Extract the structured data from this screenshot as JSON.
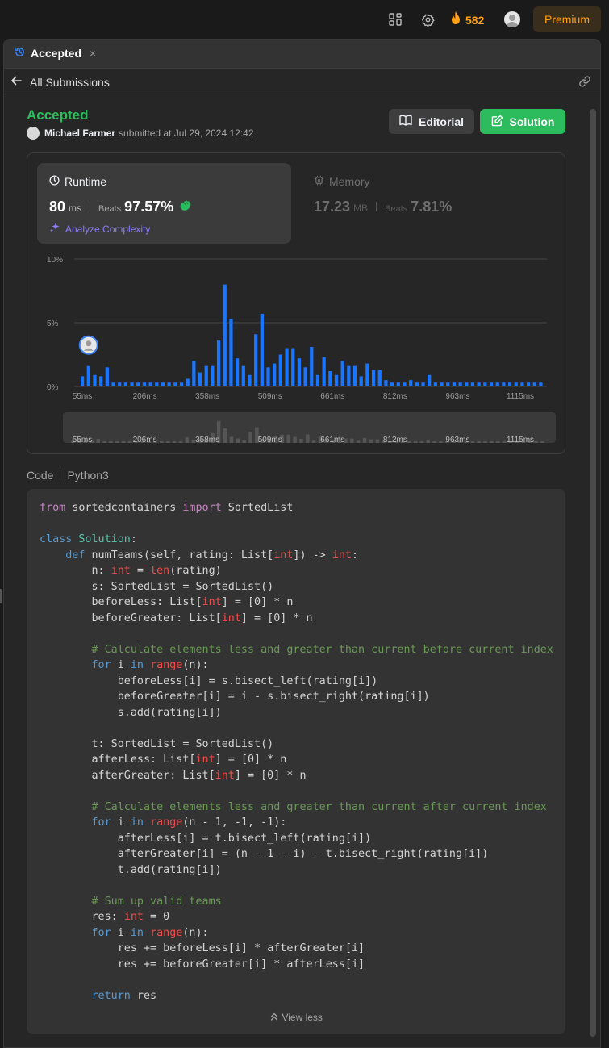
{
  "topbar": {
    "streak_count": "582",
    "premium_label": "Premium",
    "icons": [
      "grid-icon",
      "gear-icon",
      "flame-icon",
      "user-avatar"
    ]
  },
  "tab": {
    "label": "Accepted",
    "close": "×"
  },
  "subbar": {
    "back_label": "All Submissions"
  },
  "submission": {
    "status": "Accepted",
    "user": "Michael Farmer",
    "submitted_text": "submitted at Jul 29, 2024 12:42"
  },
  "buttons": {
    "editorial": "Editorial",
    "solution": "Solution"
  },
  "runtime": {
    "title": "Runtime",
    "value": "80",
    "unit": "ms",
    "beats_label": "Beats",
    "beats_value": "97.57%",
    "analyze": "Analyze Complexity"
  },
  "memory": {
    "title": "Memory",
    "value": "17.23",
    "unit": "MB",
    "beats_label": "Beats",
    "beats_value": "7.81%"
  },
  "chart_data": {
    "type": "bar",
    "ylabel": "",
    "xlabel": "",
    "ylim": [
      0,
      10
    ],
    "yticks": [
      "10%",
      "5%",
      "0%"
    ],
    "xtick_labels": [
      "55ms",
      "206ms",
      "358ms",
      "509ms",
      "661ms",
      "812ms",
      "963ms",
      "1115ms"
    ],
    "values": [
      0.8,
      1.6,
      0.9,
      0.8,
      1.5,
      0.3,
      0.3,
      0.3,
      0.3,
      0.3,
      0.3,
      0.3,
      0.3,
      0.3,
      0.3,
      0.3,
      0.3,
      0.6,
      2.0,
      1.1,
      1.6,
      1.6,
      3.6,
      8.0,
      5.3,
      2.2,
      1.6,
      0.9,
      4.1,
      5.7,
      1.5,
      1.8,
      2.5,
      3.0,
      3.0,
      2.2,
      1.5,
      3.1,
      0.9,
      2.3,
      1.2,
      0.9,
      2.0,
      1.6,
      1.6,
      0.8,
      1.8,
      1.3,
      1.3,
      0.5,
      0.3,
      0.3,
      0.3,
      0.5,
      0.3,
      0.3,
      0.9,
      0.3,
      0.3,
      0.3,
      0.3,
      0.3,
      0.3,
      0.3,
      0.3,
      0.3,
      0.3,
      0.3,
      0.3,
      0.3,
      0.3,
      0.3,
      0.3,
      0.3,
      0.3
    ],
    "marker_bar_index": 1,
    "bar_color": "#1a75ff",
    "overview_bar_color": "#555555"
  },
  "code_section": {
    "label": "Code",
    "language": "Python3",
    "view_less": "View less"
  },
  "colors": {
    "accent_green": "#2cbb5d",
    "premium_orange": "#ffa116",
    "analyze_purple": "#8b7cf6"
  }
}
